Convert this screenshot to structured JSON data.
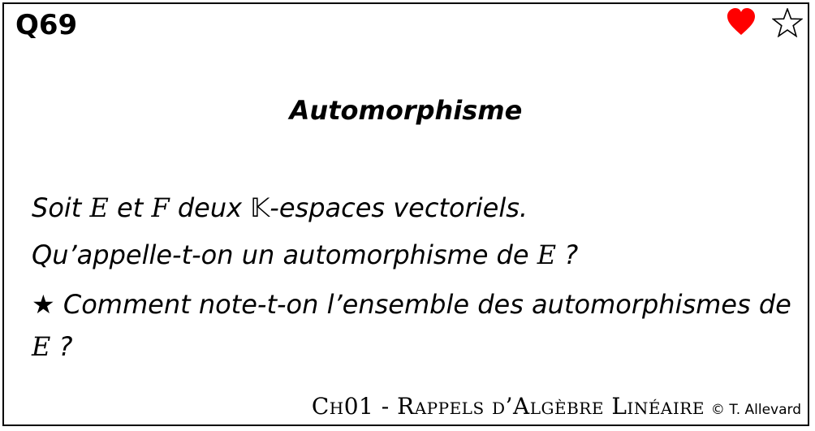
{
  "card": {
    "question_id": "Q69",
    "title": "Automorphisme",
    "line1": {
      "pre": "Soit ",
      "e": "E",
      "mid": " et ",
      "f": "F",
      "mid2": " deux ",
      "field": "𝕂",
      "post": "-espaces vectoriels."
    },
    "line2": {
      "pre": "Qu’appelle-t-on un automorphisme de ",
      "e": "E",
      "post": " ?"
    },
    "line3": {
      "star": "★",
      "pre": " Comment note-t-on l’ensemble des automorphismes de ",
      "e": "E",
      "post": " ?"
    },
    "footer": {
      "chapter": "Ch01 - Rappels d’Algèbre Linéaire",
      "copyright": "© T. Allevard"
    },
    "icons": {
      "heart": "heart-icon",
      "star": "star-icon",
      "heart_color": "#ff0000"
    }
  }
}
